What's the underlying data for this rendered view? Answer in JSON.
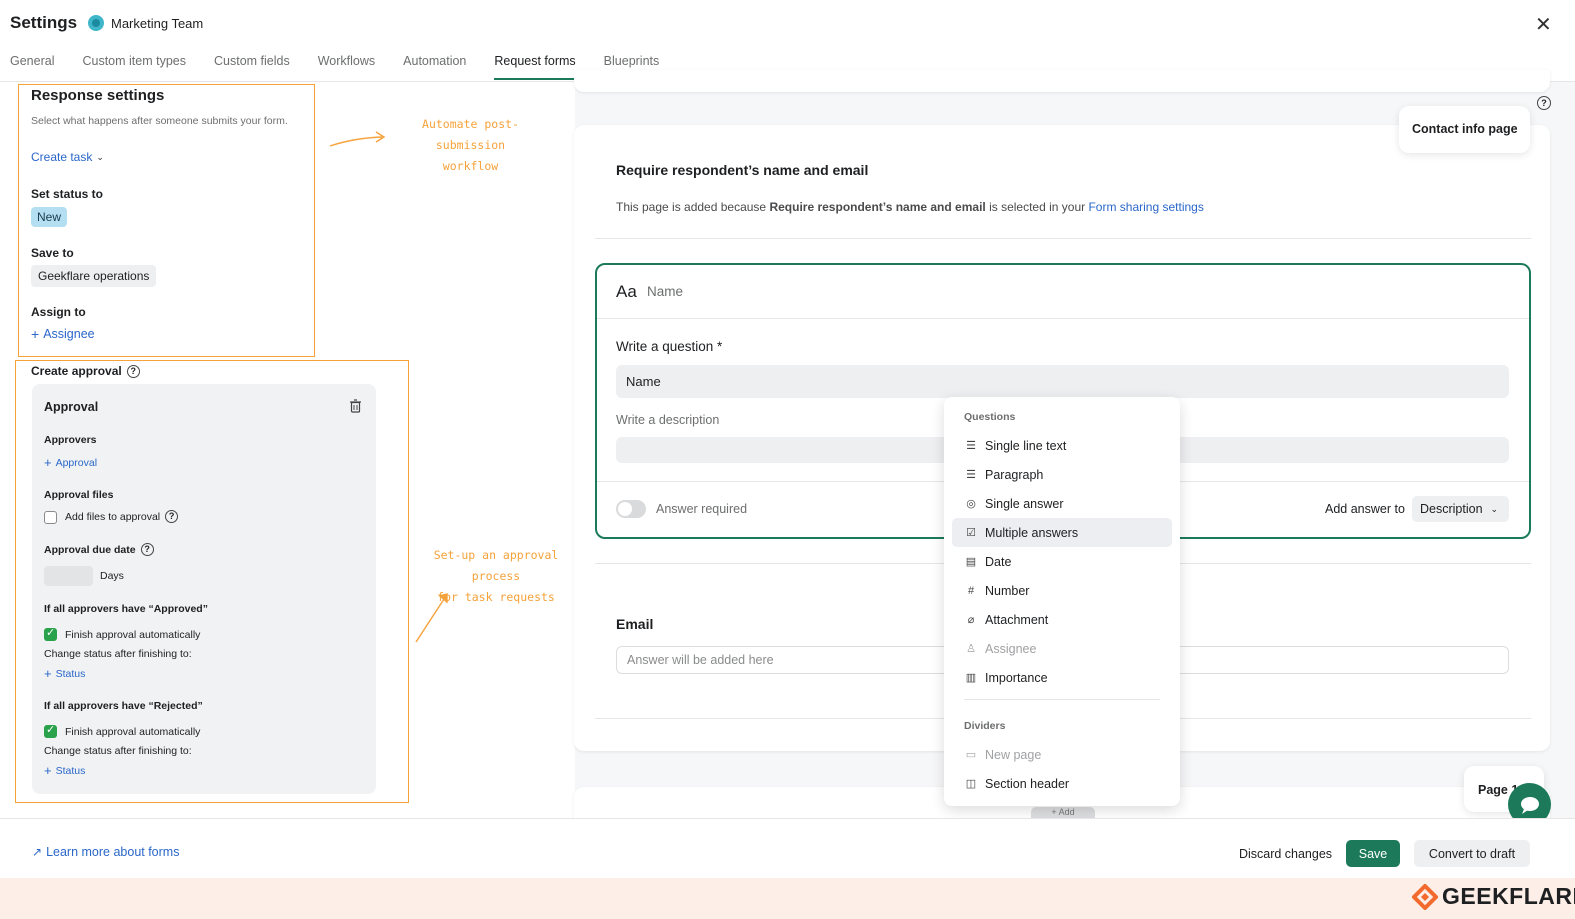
{
  "header": {
    "title": "Settings",
    "team": "Marketing Team",
    "tabs": [
      "General",
      "Custom item types",
      "Custom fields",
      "Workflows",
      "Automation",
      "Request forms",
      "Blueprints"
    ],
    "active_tab": "Request forms"
  },
  "response_settings": {
    "title": "Response settings",
    "subtitle": "Select what happens after someone submits your form.",
    "create_task": "Create task",
    "set_status_label": "Set status to",
    "status_value": "New",
    "save_to_label": "Save to",
    "save_to_value": "Geekflare operations",
    "assign_to_label": "Assign to",
    "assignee": "Assignee"
  },
  "annotations": {
    "top_line1": "Automate post-submission",
    "top_line2": "workflow",
    "bottom_line1": "Set-up an approval process",
    "bottom_line2": "for task requests"
  },
  "approval": {
    "create_label": "Create approval",
    "card_title": "Approval",
    "approvers_label": "Approvers",
    "add_approval": "Approval",
    "files_label": "Approval files",
    "add_files": "Add files to approval",
    "due_label": "Approval due date",
    "days": "Days",
    "approved_heading": "If all approvers have “Approved”",
    "finish_auto_1": "Finish approval automatically",
    "change_status_1": "Change status after finishing to:",
    "status_1": "Status",
    "rejected_heading": "If all approvers have “Rejected”",
    "finish_auto_2": "Finish approval automatically",
    "change_status_2": "Change status after finishing to:",
    "status_2": "Status"
  },
  "form": {
    "contact_tab": "Contact info page",
    "require_title": "Require respondent’s name and email",
    "desc_prefix": "This page is added because ",
    "desc_bold": "Require respondent’s name and email",
    "desc_mid": " is selected in your ",
    "desc_link": "Form sharing settings",
    "field_type_icon": "Aa",
    "field_type": "Name",
    "question_label": "Write a question *",
    "question_value": "Name",
    "description_placeholder": "Write a description",
    "answer_required": "Answer required",
    "add_answer_to": "Add answer to",
    "add_answer_value": "Description",
    "email_title": "Email",
    "email_placeholder": "Answer will be added here",
    "page_label": "Page 1",
    "add_label": "+ Add"
  },
  "menu": {
    "questions_heading": "Questions",
    "items": [
      {
        "label": "Single line text",
        "icon": "lines-icon"
      },
      {
        "label": "Paragraph",
        "icon": "paragraph-icon"
      },
      {
        "label": "Single answer",
        "icon": "check-circle-icon"
      },
      {
        "label": "Multiple answers",
        "icon": "checkbox-icon"
      },
      {
        "label": "Date",
        "icon": "calendar-icon"
      },
      {
        "label": "Number",
        "icon": "hash-icon"
      },
      {
        "label": "Attachment",
        "icon": "paperclip-icon"
      },
      {
        "label": "Assignee",
        "icon": "person-icon"
      },
      {
        "label": "Importance",
        "icon": "importance-icon"
      }
    ],
    "dividers_heading": "Dividers",
    "divider_items": [
      {
        "label": "New page",
        "icon": "new-page-icon"
      },
      {
        "label": "Section header",
        "icon": "book-icon"
      }
    ]
  },
  "footer": {
    "learn_more": "Learn more about forms",
    "discard": "Discard changes",
    "save": "Save",
    "convert": "Convert to draft",
    "brand": "GEEKFLARE"
  },
  "colors": {
    "accent_green": "#1c7a5b",
    "annotation_orange": "#f5a23a",
    "link_blue": "#2a67c9"
  }
}
